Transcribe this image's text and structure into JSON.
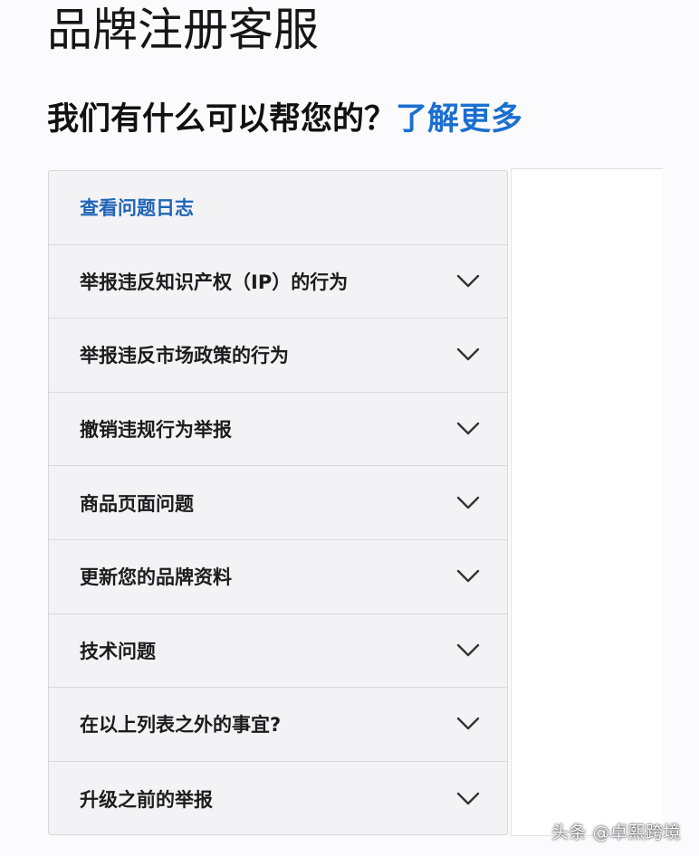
{
  "page_title": "品牌注册客服",
  "help": {
    "question": "我们有什么可以帮您的？",
    "learn_more": "了解更多"
  },
  "menu": {
    "log_label": "查看问题日志",
    "items": [
      {
        "label": "举报违反知识产权（IP）的行为",
        "icon": "chevron-down-icon"
      },
      {
        "label": "举报违反市场政策的行为",
        "icon": "chevron-down-icon"
      },
      {
        "label": "撤销违规行为举报",
        "icon": "chevron-down-icon"
      },
      {
        "label": "商品页面问题",
        "icon": "chevron-down-icon"
      },
      {
        "label": "更新您的品牌资料",
        "icon": "chevron-down-icon"
      },
      {
        "label": "技术问题",
        "icon": "chevron-down-icon"
      },
      {
        "label": "在以上列表之外的事宜?",
        "icon": "chevron-down-icon"
      },
      {
        "label": "升级之前的举报",
        "icon": "chevron-down-icon"
      }
    ]
  },
  "watermark": "头条 @卓熙跨境",
  "colors": {
    "link_blue": "#1a6fd0",
    "log_blue": "#1f65b8",
    "panel_bg": "#f3f3f5",
    "border": "#d9d9dd"
  }
}
